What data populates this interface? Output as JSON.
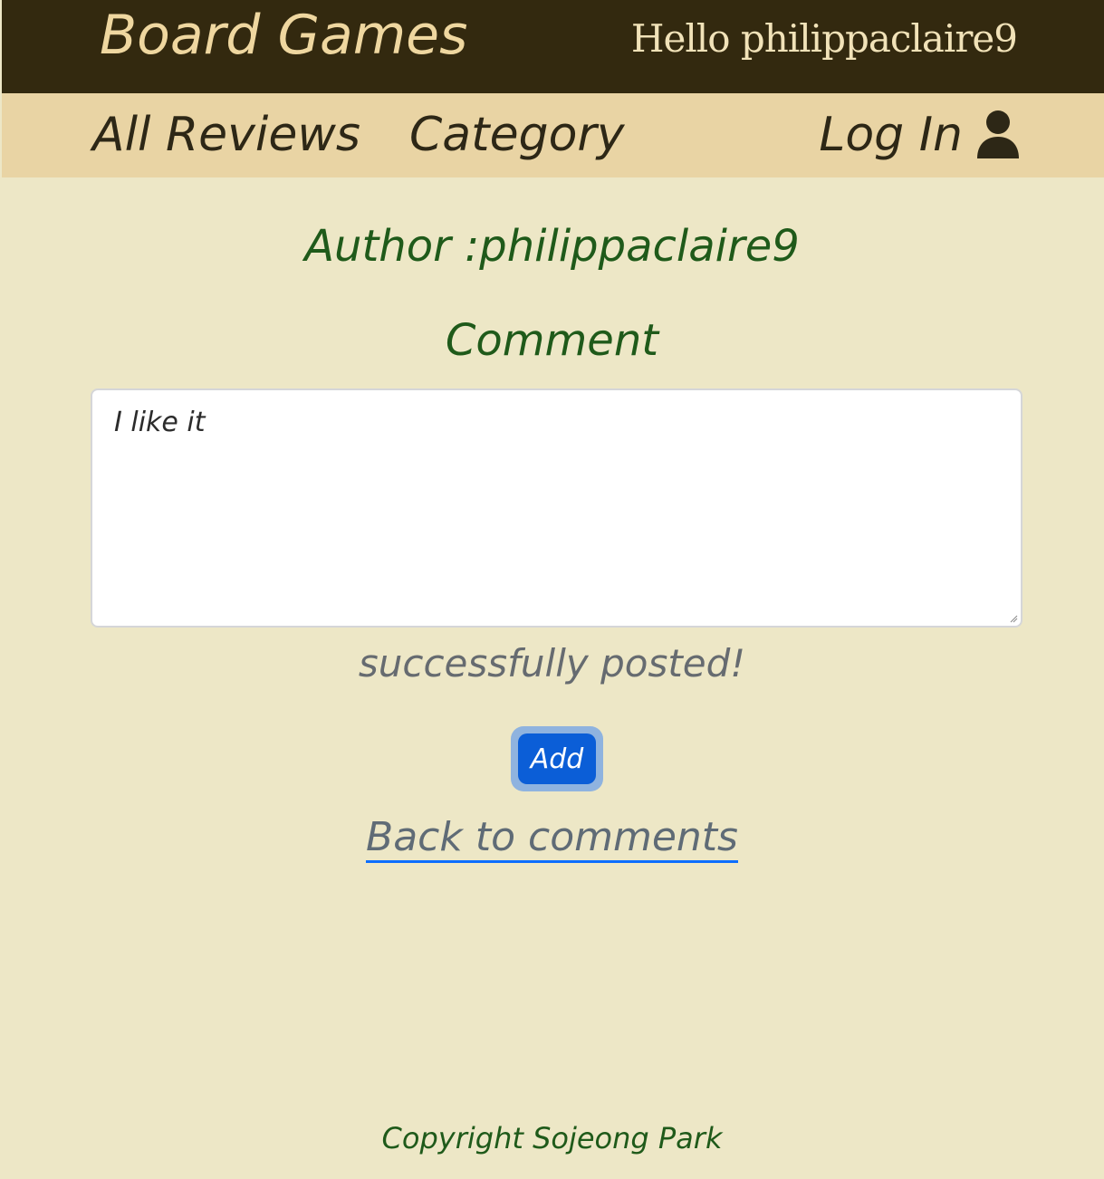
{
  "header": {
    "brand": "Board Games",
    "greeting": "Hello philippaclaire9"
  },
  "nav": {
    "all_reviews": "All Reviews",
    "category": "Category",
    "log_in": "Log In",
    "log_in_icon": "user-icon"
  },
  "main": {
    "author_label": "Author :philippaclaire9",
    "comment_heading": "Comment",
    "comment_value": "I like it",
    "status_message": "successfully posted!",
    "add_button": "Add",
    "back_link": "Back to comments"
  },
  "footer": {
    "copyright": "Copyright Sojeong Park"
  },
  "colors": {
    "topbar_bg": "#33290f",
    "navbar_bg": "#e9d4a4",
    "page_bg": "#ede7c6",
    "heading_green": "#1f5a1a",
    "button_blue": "#0b5ed7"
  }
}
